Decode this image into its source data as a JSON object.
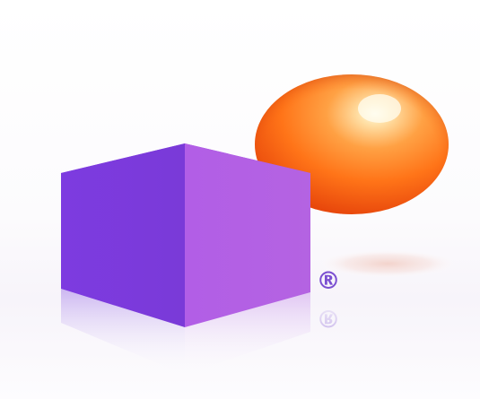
{
  "logo": {
    "registered_mark": "®",
    "shapes": [
      "purple-cube",
      "orange-sphere"
    ],
    "colors": {
      "cube_front": "#7f3fe0",
      "cube_side": "#b15de4",
      "cube_top": "#9a4be6",
      "sphere_light": "#ffd08a",
      "sphere_mid": "#ff7a1c",
      "sphere_dark": "#e8440a",
      "registered_mark_color": "#7b4fd1"
    }
  }
}
